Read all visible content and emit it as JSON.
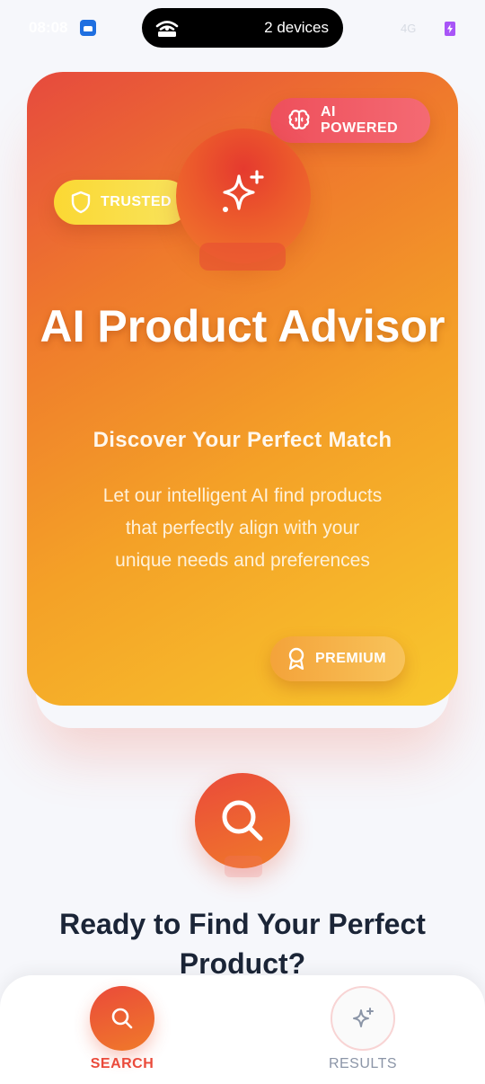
{
  "status_bar": {
    "time": "08:08",
    "connection_text": "2 devices",
    "signal": "4G",
    "battery_color": "#a855f7"
  },
  "hero": {
    "badge_ai": "AI POWERED",
    "badge_trusted": "TRUSTED",
    "badge_premium": "PREMIUM",
    "title": "AI Product Advisor",
    "subtitle": "Discover Your Perfect Match",
    "description": "Let our intelligent AI find products that perfectly align with your unique needs and preferences",
    "gradient_start": "#e64a3e",
    "gradient_end": "#f8c72d",
    "icons": [
      "sparkles-icon",
      "brain-icon",
      "shield-icon",
      "award-icon"
    ]
  },
  "section": {
    "title": "Ready to Find Your Perfect Product?",
    "icon": "search-icon"
  },
  "bottom_nav": {
    "items": [
      {
        "label": "SEARCH",
        "icon": "search-icon",
        "active": true
      },
      {
        "label": "RESULTS",
        "icon": "sparkles-icon",
        "active": false
      }
    ],
    "accent": "#ea4a3a"
  }
}
